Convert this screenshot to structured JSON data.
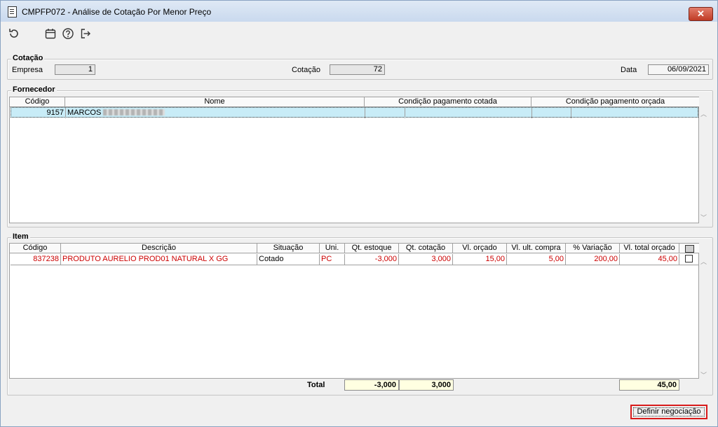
{
  "window": {
    "title": "CMPFP072 - Análise de Cotação Por Menor Preço",
    "close_label": "✕"
  },
  "toolbar": {
    "icons": [
      "refresh-icon",
      "calendar-icon",
      "help-icon",
      "exit-icon"
    ]
  },
  "cotacao": {
    "legend": "Cotação",
    "empresa_label": "Empresa",
    "empresa_value": "1",
    "cotacao_label": "Cotação",
    "cotacao_value": "72",
    "data_label": "Data",
    "data_value": "06/09/2021"
  },
  "fornecedor": {
    "legend": "Fornecedor",
    "columns": [
      "Código",
      "Nome",
      "Condição pagamento cotada",
      "Condição pagamento orçada"
    ],
    "rows": [
      {
        "codigo": "9157",
        "nome": "MARCOS"
      }
    ]
  },
  "item": {
    "legend": "Item",
    "columns": [
      "Código",
      "Descrição",
      "Situação",
      "Uni.",
      "Qt. estoque",
      "Qt. cotação",
      "Vl. orçado",
      "Vl. ult. compra",
      "% Variação",
      "Vl. total orçado"
    ],
    "rows": [
      {
        "codigo": "837238",
        "descricao": "PRODUTO AURELIO PROD01 NATURAL X GG",
        "situacao": "Cotado",
        "uni": "PC",
        "qt_estoque": "-3,000",
        "qt_cotacao": "3,000",
        "vl_orcado": "15,00",
        "vl_ult_compra": "5,00",
        "variacao": "200,00",
        "vl_total_orcado": "45,00",
        "checked": false
      }
    ],
    "total_label": "Total",
    "total_qt_estoque": "-3,000",
    "total_qt_cotacao": "3,000",
    "total_vl_total_orcado": "45,00"
  },
  "actions": {
    "define_label": "Definir negociação"
  },
  "colors": {
    "title_bar": "#c9d9ee",
    "row_highlight": "#c8ecf7",
    "accent_red": "#cc0000",
    "totals_bg": "#ffffe1"
  }
}
